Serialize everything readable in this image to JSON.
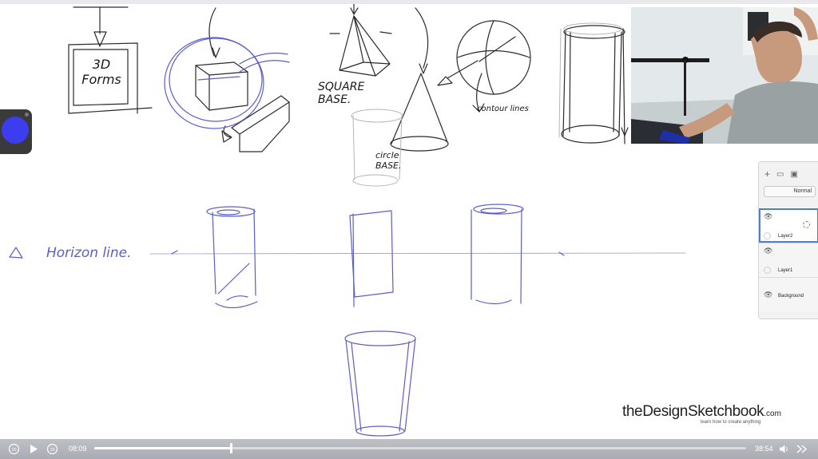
{
  "sketch": {
    "label_3d_forms": "3D\nForms",
    "label_square_base": "SQUARE\nBASE.",
    "label_circle_base": "circle\nBASE.",
    "label_contour_lines": "contour lines",
    "label_horizon_line": "Horizon line."
  },
  "layers_panel": {
    "blend_mode": "Normal",
    "layers": [
      {
        "name": "Layer2"
      },
      {
        "name": "Layer1"
      },
      {
        "name": "Background"
      }
    ]
  },
  "brand": {
    "name": "theDesignSketchbook",
    "suffix": ".com",
    "tagline": "learn how to create anything"
  },
  "player": {
    "current_time": "08:09",
    "duration": "38:54",
    "progress": 0.21,
    "skip_back_label": "15",
    "skip_forward_label": "15"
  },
  "colors": {
    "ink": "#1a1a1a",
    "blue_ink": "#5a5fc8",
    "active_color": "#3d3df0",
    "player_bar": "#b3b5bc"
  },
  "icons": [
    "play-icon",
    "skip-back-icon",
    "skip-forward-icon",
    "volume-icon",
    "fast-forward-icon",
    "eye-icon",
    "add-layer-icon",
    "folder-icon",
    "image-icon"
  ]
}
